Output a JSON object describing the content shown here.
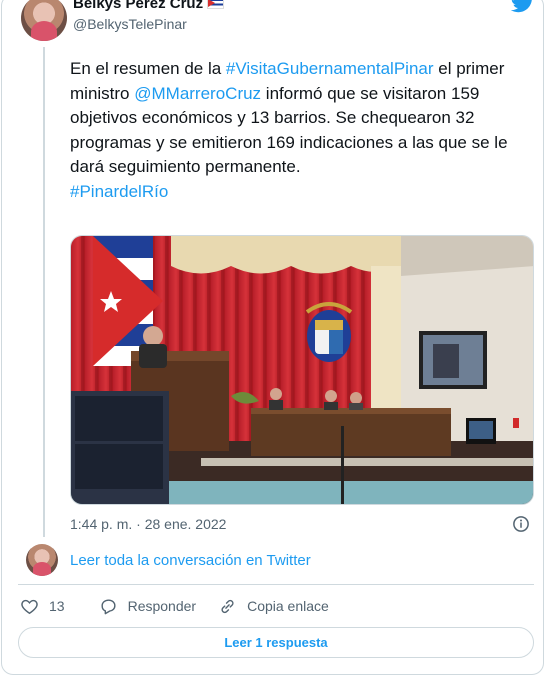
{
  "author": {
    "name": "Belkys Pérez Cruz",
    "handle": "@BelkysTelePinar",
    "flag_icon": "cuba-flag-icon"
  },
  "tweet": {
    "segments": [
      {
        "text": "En el resumen de la ",
        "type": "text"
      },
      {
        "text": "#VisitaGubernamentalPinar",
        "type": "link"
      },
      {
        "text": " el primer ministro ",
        "type": "text"
      },
      {
        "text": "@MMarreroCruz",
        "type": "link"
      },
      {
        "text": " informó que se visitaron 159 objetivos económicos y 13 barrios. Se chequearon 32 programas y se emitieron 169 indicaciones a las que se le dará seguimiento permanente.",
        "type": "text"
      },
      {
        "text": "#PinardelRío",
        "type": "link",
        "newline": true
      }
    ],
    "timestamp": "1:44 p. m. · 28 ene. 2022"
  },
  "conversation_link": "Leer toda la conversación en Twitter",
  "actions": {
    "likes": "13",
    "reply": "Responder",
    "copy_link": "Copia enlace"
  },
  "reply_button": "Leer 1 respuesta",
  "colors": {
    "link": "#1d9bf0",
    "muted": "#536471",
    "border": "#cfd9de"
  }
}
